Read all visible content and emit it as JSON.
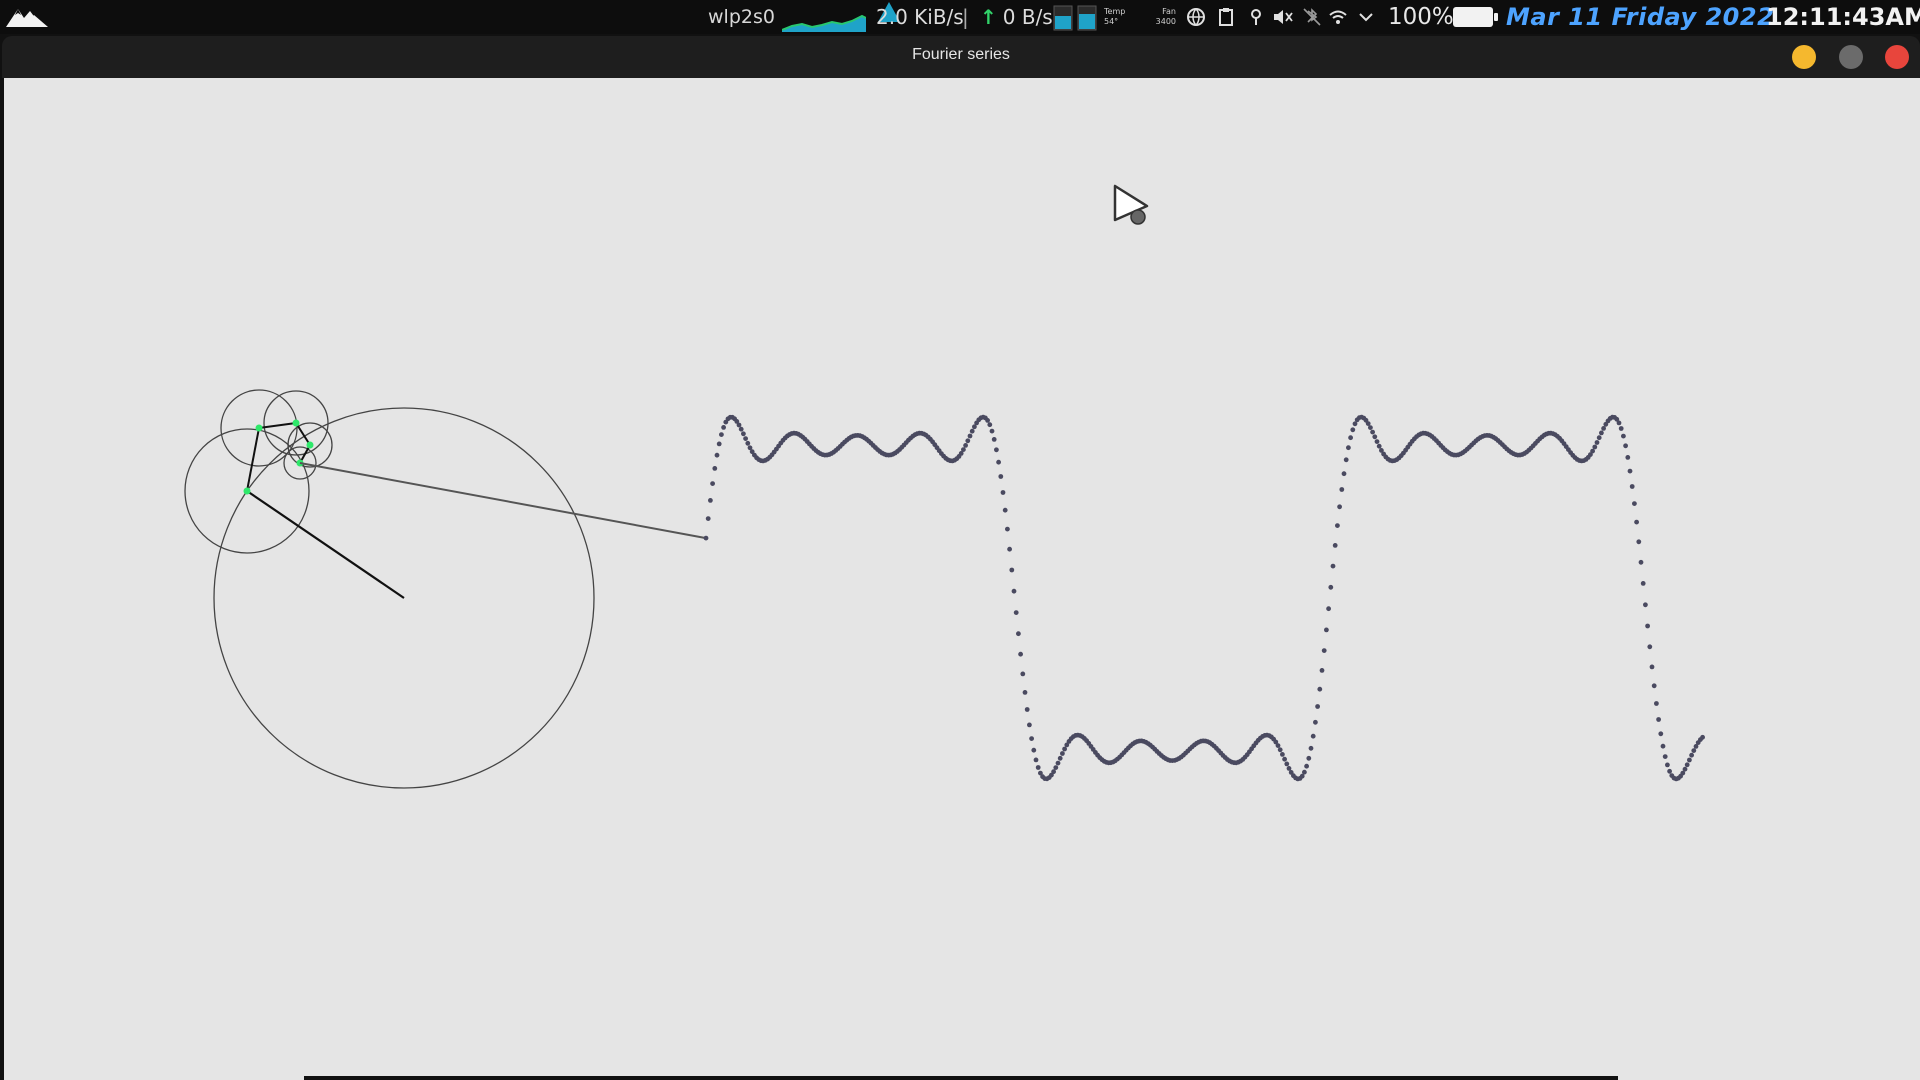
{
  "window": {
    "title": "Fourier series"
  },
  "topbar": {
    "logo_icon": "mountain-logo-icon",
    "network_interface": "wlp2s0",
    "download_rate": "2.0 KiB/s",
    "rate_separator": "|",
    "upload_rate": "0 B/s",
    "temp_label": "Temp",
    "fan_label": "Fan",
    "temp_value": "54°",
    "fan_value": "3400",
    "tray_icons": [
      "globe-icon",
      "clipboard-icon",
      "location-pin-icon",
      "speaker-muted-icon",
      "bluetooth-off-icon",
      "wifi-icon",
      "chevron-down-icon"
    ],
    "battery_percent": "100%",
    "date": "Mar 11 Friday 2022",
    "time": "12:11:43AM"
  },
  "colors": {
    "topbar_bg": "#0d0d0d",
    "titlebar_bg": "#1e1e1e",
    "canvas_bg": "#e5e5e5",
    "date_blue": "#4da3ff",
    "minimize": "#f5b82e",
    "maximize": "#6b6b6b",
    "close": "#e8453c",
    "wave": "#4a4a60",
    "joint": "#2ee86a",
    "net_graph": "#1fa3c9",
    "net_graph_green": "#28c76f"
  }
}
